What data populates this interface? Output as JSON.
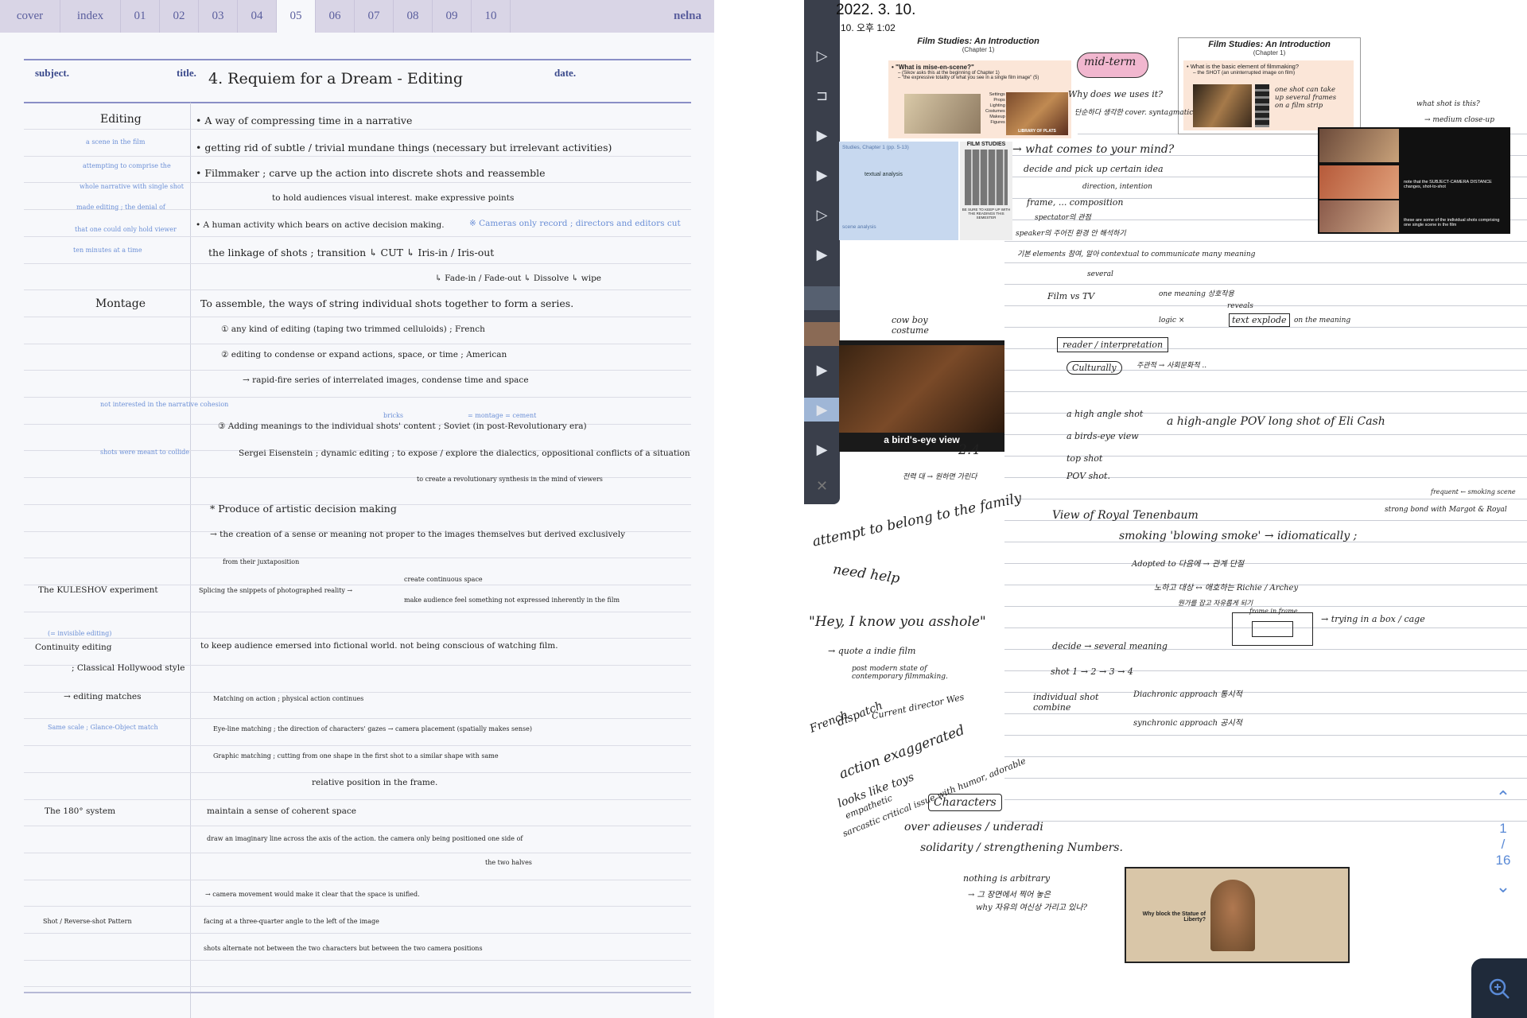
{
  "left": {
    "tabs": [
      "cover",
      "index",
      "01",
      "02",
      "03",
      "04",
      "05",
      "06",
      "07",
      "08",
      "09",
      "10"
    ],
    "active_tab": "05",
    "brand": "nelna",
    "header": {
      "subject_label": "subject.",
      "title_label": "title.",
      "date_label": "date.",
      "title": "4. Requiem for a Dream - Editing"
    },
    "notes": {
      "editing_kw": "Editing",
      "editing_side": [
        "a scene in the film",
        "attempting to comprise the",
        "whole narrative with single shot",
        "made editing ; the denial of",
        "that one could only hold viewer",
        "ten minutes at a time"
      ],
      "e1": "• A way of compressing time in a narrative",
      "e2": "• getting rid of subtle / trivial mundane things (necessary but irrelevant activities)",
      "e3": "• Filmmaker ; carve up the action into discrete shots and reassemble",
      "e4": "to hold audiences visual interest. make expressive points",
      "e5": "• A human activity which bears on active decision making.",
      "e5b": "※ Cameras only record ; directors and editors cut",
      "e6": "the linkage of shots ; transition    ↳ CUT   ↳ Iris-in / Iris-out",
      "e7": "↳ Fade-in / Fade-out   ↳ Dissolve   ↳ wipe",
      "montage_kw": "Montage",
      "m1": "To assemble, the ways of string individual shots together to form a series.",
      "m2": "① any kind of editing (taping two trimmed celluloids)   ; French",
      "m3": "② editing to condense or expand actions, space, or time ; American",
      "m4": "→ rapid-fire series of interrelated images, condense time and space",
      "m_side1": "not interested in the narrative cohesion",
      "m_side2": "shots were meant to collide",
      "m5_sup": "bricks",
      "m5_sup2": "= montage = cement",
      "m5": "③ Adding meanings to the individual shots' content   ; Soviet (in post-Revolutionary era)",
      "m6": "Sergei Eisenstein ; dynamic editing ; to expose / explore the dialectics, oppositional conflicts of a situation",
      "m7": "to create a revolutionary synthesis in the mind of viewers",
      "m8": "* Produce of artistic decision making",
      "m9": "→ the creation of a sense or meaning not proper to the images themselves but derived exclusively",
      "m10": "from their juxtaposition",
      "kuleshov_kw": "The KULESHOV experiment",
      "k1": "Splicing the snippets of photographed reality →",
      "k2a": "create continuous space",
      "k2b": "make audience feel something not expressed inherently in the film",
      "cont_side": "(= invisible editing)",
      "cont_kw": "Continuity editing",
      "cont_kw2": "; Classical Hollywood style",
      "c1": "to keep audience emersed into fictional world. not being conscious of watching film.",
      "match_kw": "→ editing matches",
      "match_side": "Same scale ; Glance-Object match",
      "c2": "Matching on action  ; physical action continues",
      "c3": "Eye-line matching  ; the direction of characters' gazes → camera placement (spatially makes sense)",
      "c4": "Graphic matching  ; cutting from one shape in the first shot to a similar shape with same",
      "c5": "relative position in the frame.",
      "system_kw": "The 180° system",
      "s1": "maintain a sense of coherent space",
      "s2": "draw an imaginary line across the axis of the action. the camera only being positioned one side of",
      "s3": "the two halves",
      "s4": "→ camera movement would make it clear that the space is unified.",
      "shot_kw": "Shot / Reverse-shot Pattern",
      "sr1": "facing at a three-quarter angle to the left of the image",
      "sr2": "shots alternate not between the two characters but between the two camera positions"
    }
  },
  "right": {
    "date": "2022. 3. 10.",
    "time": "10. 오후 1:02",
    "slide1": {
      "title": "Film Studies: An Introduction",
      "chapter": "(Chapter 1)",
      "bullet": "• \"What is mise-en-scene?\"",
      "sub1": "– (Sikov asks this at the beginning of Chapter 1)",
      "sub2": "– \"the expressive totality of what you see in a single film image\" (5)",
      "labels": [
        "Settings",
        "Props",
        "Lighting",
        "Costumes",
        "Makeup",
        "Figures"
      ],
      "poster": "LIBRARY OF PLATS"
    },
    "slide2": {
      "title": "Film Studies: An Introduction",
      "chapter": "(Chapter 1)",
      "bullet": "• What is the basic element of filmmaking?",
      "sub": "– the SHOT (an uninterrupted image on film)"
    },
    "slide3": {
      "head": "Studies, Chapter 1 (pp. 5-13)",
      "body": "textual analysis",
      "tail": "scene analysis",
      "book": "FILM STUDIES",
      "book_note": "BE SURE TO KEEP UP WITH THE READINGS THIS SEMESTER"
    },
    "slide4": {
      "note1": "note that the SUBJECT-CAMERA DISTANCE changes, shot-to-shot",
      "note2": "these are some of the individual shots comprising one single scene in the film"
    },
    "caption_birdseye": "a bird's-eye view",
    "video_caption": "Why block the Statue of Liberty?",
    "ink": {
      "midterm": "mid-term",
      "why_use": "Why does we uses it?",
      "why_kr": "단순하다 생각한 cover. syntagmatic",
      "one_shot": "one shot can take up several frames on a film strip",
      "what_shot": "what shot is this?",
      "medium_close": "→ medium close-up",
      "what_comes": "→ what comes to your mind?",
      "decide": "decide and pick up certain idea",
      "direction": "direction, intention",
      "frame": "frame, ... composition",
      "kr1": "spectator의 관점",
      "speaker": "speaker의 주어진 환경 안 해석하기",
      "kr_line": "기본 elements 참여, 알아 contextual to communicate many meaning",
      "several": "several",
      "film_tv": "Film vs TV",
      "one_meaning": "one meaning 상호작용",
      "reveals": "reveals",
      "text_explode": "text explode",
      "logic": "logic ×",
      "on_meaning": "on the meaning",
      "reader": "reader / interpretation",
      "culturally": "Culturally",
      "kr_note": "주관적 → 사회문화적 ..",
      "cowboy": "cow boy costume",
      "high_angle": "a high angle shot",
      "high_angle_pov": "a high-angle POV long shot of Eli Cash",
      "birds_eye": "a birds-eye view",
      "top_shot": "top shot",
      "pov_shot": "POV shot.",
      "num24": "2.4",
      "kr_jump": "전력 대 → 원하면 가린다",
      "attempt": "attempt to belong to the family",
      "need_help": "need help",
      "view_royal": "View of Royal Tenenbaum",
      "strong_bond": "strong bond with Margot & Royal",
      "frequent": "frequent ← smoking scene",
      "smoking": "smoking 'blowing smoke'  → idiomatically ;",
      "adopted": "Adopted to 다음에 → 관계 단절",
      "kr_rel": "노하고 대상 ↔ 애호하는 Richie / Archey",
      "hey": "\"Hey, I know you asshole\"",
      "quote": "→ quote a indie film",
      "post_modern": "post modern state of contemporary filmmaking.",
      "frame_in_frame": "frame in frame",
      "trying": "→ trying in a box / cage",
      "kr_frame": "뭔가를 잡고 자유롭게 되기",
      "french": "French",
      "dispatch": "dispatch",
      "director": "Current director Wes",
      "decide_meaning": "decide → several meaning",
      "shot_seq": "shot 1 → 2 → 3 → 4",
      "individual": "individual shot combine",
      "diachronic": "Diachronic approach 통시적",
      "synchronic": "synchronic approach 공시적",
      "action": "action exaggerated",
      "looks": "looks like toys",
      "sarcastic": "sarcastic critical issue with humor, adorable",
      "empathetic": "empathetic",
      "characters": "Characters",
      "over": "over adieuses / underadi",
      "solidarity": "solidarity / strengthening Numbers.",
      "nothing": "nothing is arbitrary",
      "kr_bottom1": "→ 그 장면에서 찍어 놓은",
      "kr_bottom2": "why 자유의 여신상 가리고 있나?"
    },
    "pager": {
      "current": "1",
      "sep": "/",
      "total": "16"
    }
  },
  "colors": {
    "tabbar": "#d9d5e6",
    "tab_text": "#5b5f9e",
    "header_rule": "#8a8fc6",
    "side_note_blue": "#6b8fd6",
    "toolstrip": "#3a3f4b",
    "pager": "#5a8ad6",
    "midterm_highlight": "#f1b7cf"
  },
  "icons": [
    "up-chevron-icon",
    "down-chevron-icon",
    "zoom-in-icon",
    "close-icon",
    "play-icon"
  ]
}
